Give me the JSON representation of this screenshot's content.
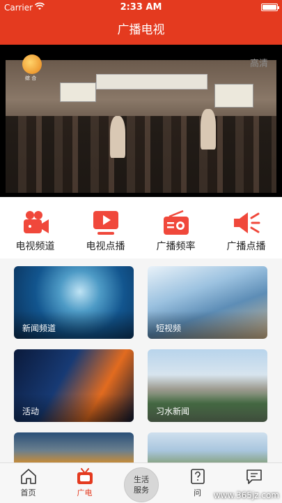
{
  "status_bar": {
    "carrier": "Carrier",
    "time": "2:33 AM"
  },
  "nav": {
    "title": "广播电视"
  },
  "video": {
    "channel_logo_text": "综 合",
    "quality_label": "高清"
  },
  "menu": [
    {
      "label": "电视频道",
      "icon": "video-camera-icon"
    },
    {
      "label": "电视点播",
      "icon": "play-icon"
    },
    {
      "label": "广播频率",
      "icon": "radio-icon"
    },
    {
      "label": "广播点播",
      "icon": "speaker-icon"
    }
  ],
  "cards": [
    {
      "caption": "新闻频道"
    },
    {
      "caption": "短视频"
    },
    {
      "caption": "活动"
    },
    {
      "caption": "习水新闻"
    }
  ],
  "tabs": [
    {
      "label": "首页",
      "icon": "home-icon"
    },
    {
      "label": "广电",
      "icon": "tv-icon",
      "active": true
    },
    {
      "label_line1": "生活",
      "label_line2": "服务"
    },
    {
      "label": "问",
      "icon": "question-icon"
    },
    {
      "label": "",
      "icon": "message-icon"
    }
  ],
  "watermark": "www.365jz.com",
  "colors": {
    "brand": "#e43a1f",
    "icon_red": "#f0483b"
  }
}
